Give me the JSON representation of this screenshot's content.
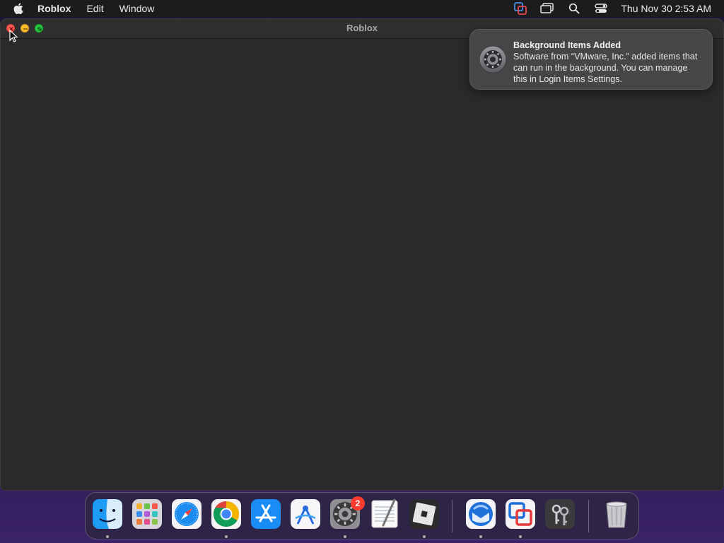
{
  "menubar": {
    "app_name": "Roblox",
    "items": [
      "Edit",
      "Window"
    ],
    "clock": "Thu Nov 30  2:53 AM"
  },
  "window": {
    "title": "Roblox"
  },
  "notification": {
    "title": "Background Items Added",
    "body": "Software from “VMware, Inc.” added items that can run in the background. You can manage this in Login Items Settings.",
    "icon": "gear-icon"
  },
  "dock": {
    "apps": [
      {
        "name": "finder",
        "running": true
      },
      {
        "name": "launchpad",
        "running": false
      },
      {
        "name": "safari",
        "running": false
      },
      {
        "name": "chrome",
        "running": true
      },
      {
        "name": "app-store",
        "running": false
      },
      {
        "name": "xcode-instruments",
        "running": false
      },
      {
        "name": "system-settings",
        "running": true,
        "badge": "2"
      },
      {
        "name": "textedit",
        "running": false
      },
      {
        "name": "roblox",
        "running": true
      },
      {
        "name": "thunderbird",
        "running": true
      },
      {
        "name": "vmware-fusion",
        "running": true
      },
      {
        "name": "keychain-access",
        "running": false
      },
      {
        "name": "trash",
        "running": false
      }
    ]
  },
  "colors": {
    "close": "#ff5f57",
    "minimize": "#febc2e",
    "maximize": "#28c840",
    "badge": "#ff3b30"
  }
}
